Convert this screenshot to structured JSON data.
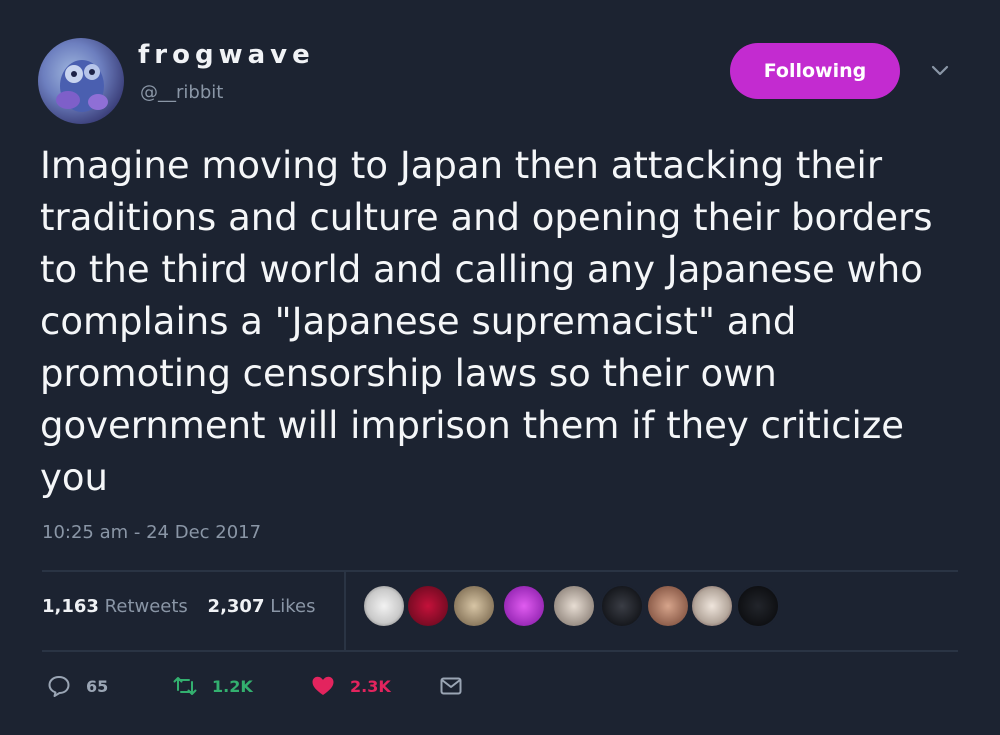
{
  "user": {
    "display_name": "frogwave",
    "handle": "@__ribbit",
    "follow_label": "Following"
  },
  "tweet": {
    "text": "Imagine moving to Japan then attacking their traditions and culture and opening their borders to the third world and calling any Japanese who complains a \"Japanese supremacist\" and promoting censorship laws so their own government will imprison them if they criticize you",
    "timestamp": "10:25 am - 24 Dec 2017"
  },
  "stats": {
    "retweets_count": "1,163",
    "retweets_label": "Retweets",
    "likes_count": "2,307",
    "likes_label": "Likes"
  },
  "actions": {
    "reply_count": "65",
    "retweet_count": "1.2K",
    "like_count": "2.3K"
  },
  "colors": {
    "background": "#1c2331",
    "following_button": "#c32bd0",
    "retweet": "#33b06f",
    "like": "#e3245e",
    "muted_text": "#8a96a6"
  },
  "icons": {
    "menu": "chevron-down-icon",
    "reply": "reply-icon",
    "retweet": "retweet-icon",
    "like": "heart-icon",
    "dm": "mail-icon"
  }
}
